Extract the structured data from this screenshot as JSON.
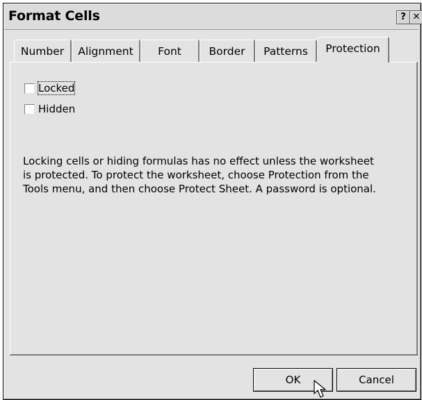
{
  "window": {
    "title": "Format Cells"
  },
  "titlebar_buttons": {
    "help": "?",
    "close": "✕"
  },
  "tabs": [
    {
      "label": "Number"
    },
    {
      "label": "Alignment"
    },
    {
      "label": "Font"
    },
    {
      "label": "Border"
    },
    {
      "label": "Patterns"
    },
    {
      "label": "Protection"
    }
  ],
  "active_tab": "Protection",
  "protection": {
    "locked": {
      "label": "Locked",
      "checked": false
    },
    "hidden": {
      "label": "Hidden",
      "checked": false
    },
    "description": "Locking cells or hiding formulas has no effect unless the worksheet is protected. To protect the worksheet, choose Protection from the Tools menu, and then choose Protect Sheet. A password is optional."
  },
  "footer": {
    "ok_label": "OK",
    "cancel_label": "Cancel"
  }
}
